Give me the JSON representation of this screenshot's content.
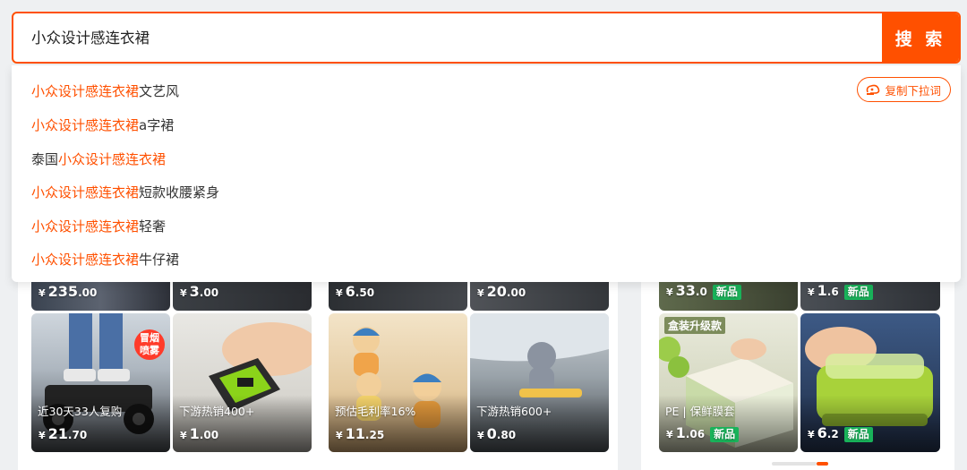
{
  "search": {
    "query": "小众设计感连衣裙",
    "button_label": "搜 索"
  },
  "dropdown": {
    "copy_label": "复制下拉词",
    "suggestions": [
      {
        "pre": "",
        "hl": "小众设计感连衣裙",
        "post": "文艺风"
      },
      {
        "pre": "",
        "hl": "小众设计感连衣裙",
        "post": "a字裙"
      },
      {
        "pre": "泰国",
        "hl": "小众设计感连衣裙",
        "post": ""
      },
      {
        "pre": "",
        "hl": "小众设计感连衣裙",
        "post": "短款收腰紧身"
      },
      {
        "pre": "",
        "hl": "小众设计感连衣裙",
        "post": "轻奢"
      },
      {
        "pre": "",
        "hl": "小众设计感连衣裙",
        "post": "牛仔裙"
      }
    ]
  },
  "products_top": [
    {
      "price_int": "235",
      "price_dec": ".00",
      "new": ""
    },
    {
      "price_int": "3",
      "price_dec": ".00",
      "new": ""
    },
    {
      "price_int": "6",
      "price_dec": ".50",
      "new": ""
    },
    {
      "price_int": "20",
      "price_dec": ".00",
      "new": ""
    },
    {
      "price_int": "33",
      "price_dec": ".0",
      "new": "新品"
    },
    {
      "price_int": "1",
      "price_dec": ".6",
      "new": "新品"
    }
  ],
  "products_bottom": [
    {
      "caption": "近30天33人复购",
      "price_int": "21",
      "price_dec": ".70",
      "new": "",
      "overlay": "冒烟\n喷雾"
    },
    {
      "caption": "下游热销400+",
      "price_int": "1",
      "price_dec": ".00",
      "new": ""
    },
    {
      "caption": "预估毛利率16%",
      "price_int": "11",
      "price_dec": ".25",
      "new": ""
    },
    {
      "caption": "下游热销600+",
      "price_int": "0",
      "price_dec": ".80",
      "new": ""
    },
    {
      "caption": "PE | 保鲜膜套",
      "price_int": "1",
      "price_dec": ".06",
      "new": "新品",
      "overlay": "盒装升级款"
    },
    {
      "caption": "",
      "price_int": "6",
      "price_dec": ".2",
      "new": "新品"
    }
  ],
  "currency_symbol": "¥",
  "colors": {
    "accent": "#ff5000",
    "new_badge": "#19b35a"
  }
}
